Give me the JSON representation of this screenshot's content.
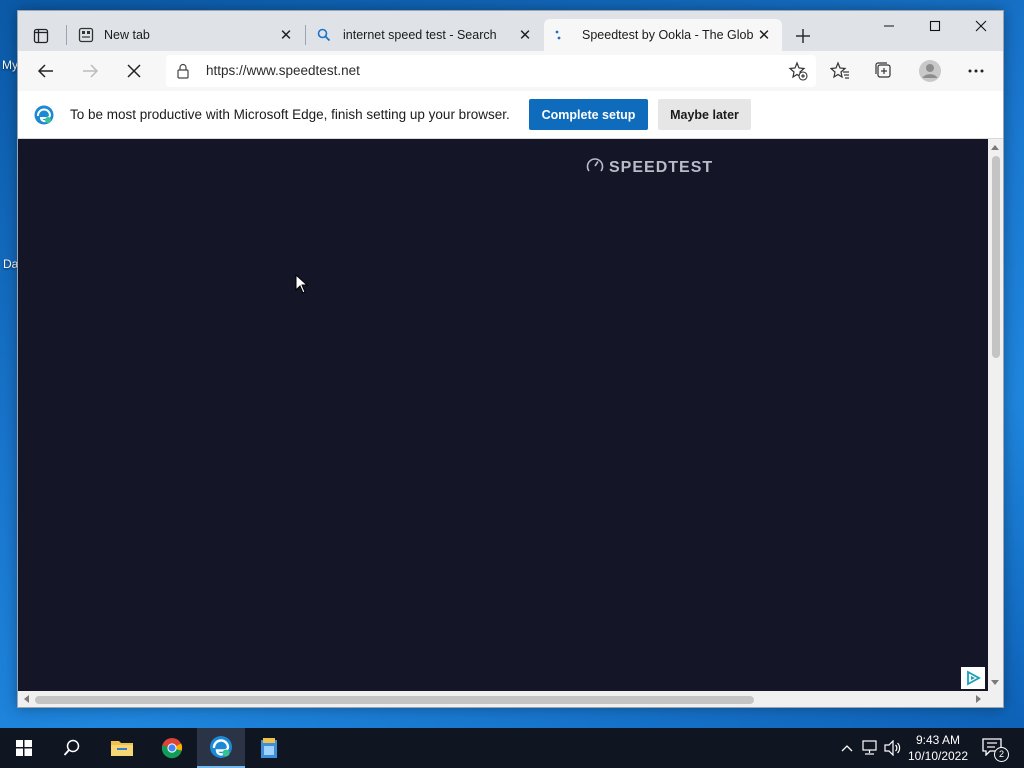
{
  "desktop": {
    "labels": [
      "My",
      "Da"
    ]
  },
  "browser": {
    "tabs": [
      {
        "title": "New tab",
        "icon": "new-tab-icon"
      },
      {
        "title": "internet speed test - Search",
        "icon": "search-icon"
      },
      {
        "title": "Speedtest by Ookla - The Global",
        "icon": "loading-icon"
      }
    ],
    "close_glyph": "✕",
    "address": {
      "url": "https://www.speedtest.net"
    },
    "infobar": {
      "message": "To be most productive with Microsoft Edge, finish setting up your browser.",
      "primary_label": "Complete setup",
      "secondary_label": "Maybe later"
    },
    "page": {
      "brand": "SPEEDTEST",
      "background": "#141526"
    }
  },
  "taskbar": {
    "time": "9:43 AM",
    "date": "10/10/2022",
    "notification_count": "2"
  },
  "colors": {
    "accent": "#0f6cbd",
    "taskbar": "#101522"
  }
}
